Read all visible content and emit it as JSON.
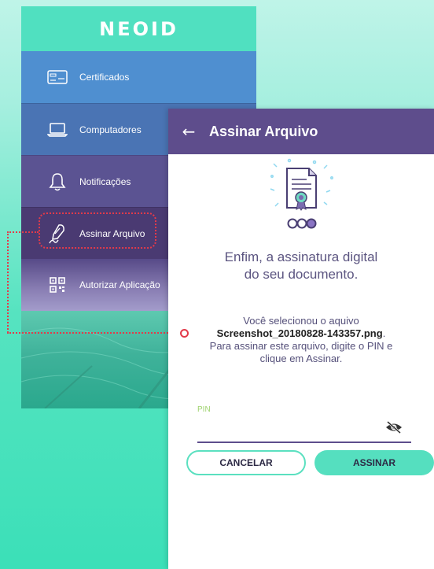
{
  "brand": {
    "logo": "NEOID"
  },
  "sidebar": {
    "items": [
      {
        "label": "Certificados",
        "icon": "certificate-card-icon"
      },
      {
        "label": "Computadores",
        "icon": "laptop-icon"
      },
      {
        "label": "Notificações",
        "icon": "bell-icon"
      },
      {
        "label": "Assinar Arquivo",
        "icon": "signature-pen-icon"
      },
      {
        "label": "Autorizar Aplicação",
        "icon": "qr-code-icon"
      }
    ]
  },
  "screen": {
    "title": "Assinar Arquivo",
    "back_icon": "arrow-left-icon",
    "headline_line1": "Enfim, a assinatura digital",
    "headline_line2": "do seu documento.",
    "info_line1": "Você selecionou o aquivo",
    "filename": "Screenshot_20180828-143357.png",
    "filename_suffix": ".",
    "info_line2": "Para assinar este arquivo, digite o PIN e",
    "info_line3": "clique em Assinar.",
    "pin_label": "PIN",
    "pin_value": "",
    "cancel_label": "CANCELAR",
    "sign_label": "ASSINAR"
  },
  "colors": {
    "accent": "#55dfbf",
    "appbar": "#5e4d8c",
    "highlight": "#e23a4a"
  }
}
